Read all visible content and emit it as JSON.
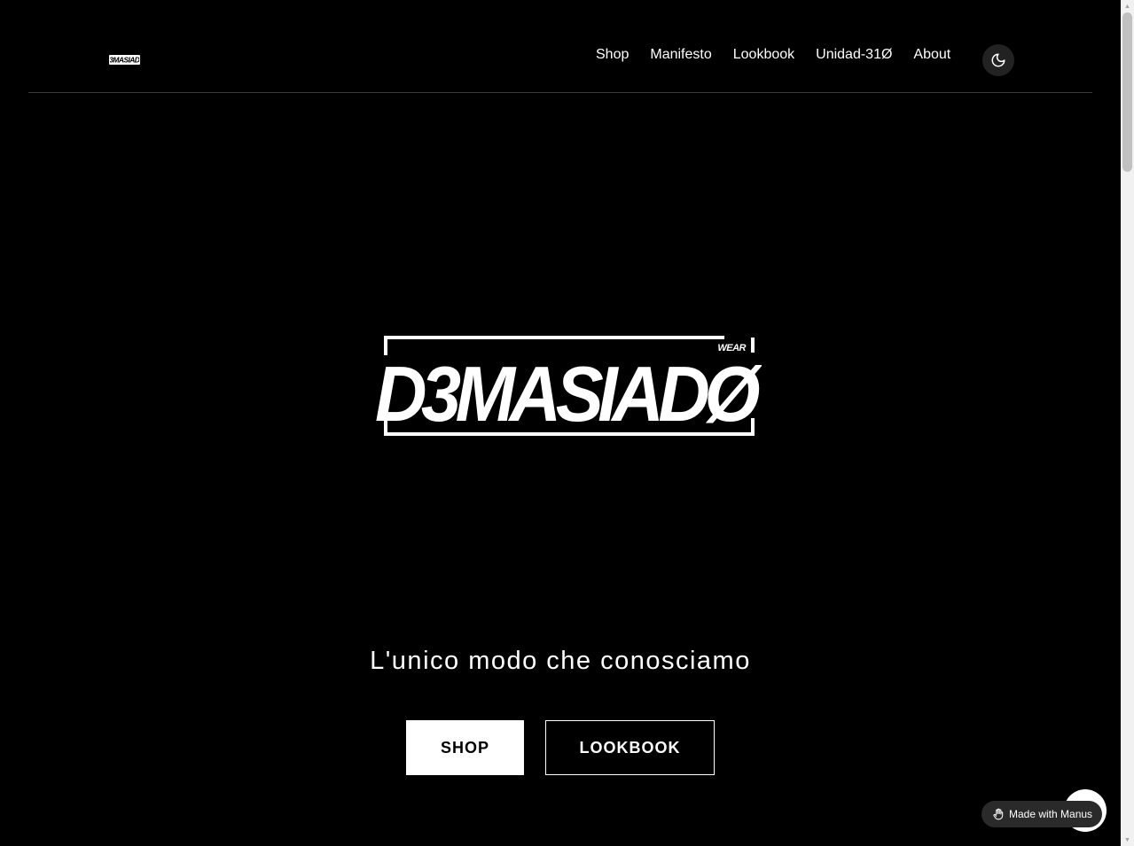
{
  "brand": {
    "name": "D3MASIADØ",
    "wordmark": "D3MASIADØ",
    "sub_mark": "WEAR"
  },
  "nav": {
    "items": [
      {
        "label": "Shop"
      },
      {
        "label": "Manifesto"
      },
      {
        "label": "Lookbook"
      },
      {
        "label": "Unidad-31Ø"
      },
      {
        "label": "About"
      }
    ],
    "theme_icon": "moon-icon"
  },
  "hero": {
    "tagline": "L'unico modo che conosciamo",
    "primary_button": "SHOP",
    "secondary_button": "LOOKBOOK"
  },
  "badge": {
    "label": "Made with Manus",
    "icon": "manus-hand-icon"
  },
  "colors": {
    "background": "#000000",
    "foreground": "#ffffff",
    "divider": "#3a3a3a"
  }
}
